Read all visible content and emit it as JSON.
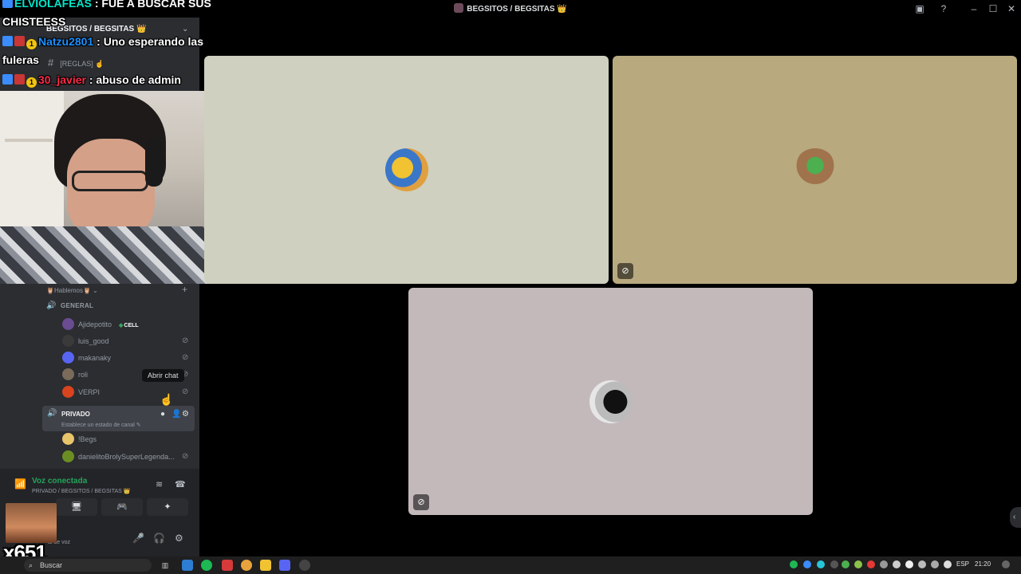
{
  "window": {
    "title": "BEGSITOS / BEGSITAS 👑",
    "icons": [
      "inbox-icon",
      "help-icon",
      "minimize-icon",
      "maximize-icon",
      "close-icon"
    ]
  },
  "sidebar": {
    "server_name": "BEGSITOS / BEGSITAS 👑",
    "rules_channel": "[REGLAS] ☝️",
    "category": "🦉Hablemos🦉",
    "voice_channels": [
      {
        "name": "GENERAL",
        "members": [
          {
            "name": "Ajidepotito",
            "tag": "CELL",
            "tag_color": "#23a55a",
            "muted": false,
            "avatar_color": "#6a4c93"
          },
          {
            "name": "luis_good",
            "muted": true,
            "avatar_color": "#3a3a3a"
          },
          {
            "name": "makanaky",
            "muted": true,
            "avatar_color": "#5865f2"
          },
          {
            "name": "roli",
            "muted": true,
            "avatar_color": "#7a6b5a"
          },
          {
            "name": "VERPI",
            "muted": true,
            "avatar_color": "#d9441f"
          }
        ]
      },
      {
        "name": "PRIVADO",
        "status": "Establece un estado de canal",
        "members": [
          {
            "name": "!Begs",
            "muted": false,
            "avatar_color": "#e8c46a"
          },
          {
            "name": "danielitoBrolySuperLegenda...",
            "muted": true,
            "avatar_color": "#6b8e23"
          }
        ]
      }
    ],
    "tooltip": "Abrir chat"
  },
  "voice_panel": {
    "status": "Voz conectada",
    "location": "PRIVADO / BEGSITOS / BEGSITAS 👑",
    "user_subtext": "al de voz"
  },
  "overlay": {
    "chat": [
      {
        "user": "ELVIOLAFEAS",
        "sep": " : ",
        "text": "FUE A BUSCAR SUS"
      },
      {
        "user": "",
        "sep": "",
        "text": "CHISTEESS"
      },
      {
        "user": "Natzu2801",
        "sep": " : ",
        "text": "Uno esperando las"
      },
      {
        "user": "",
        "sep": "",
        "text": "fuleras"
      },
      {
        "user": "30_javier",
        "sep": " : ",
        "text": "abuso de admin"
      }
    ],
    "badge_count": "1",
    "meme_counter": "x651"
  },
  "stage": {
    "tiles": [
      {
        "label": "participant-1",
        "bg": "#cfd0c0",
        "mic_muted": false
      },
      {
        "label": "participant-2",
        "bg": "#b8a97f",
        "mic_muted": true
      },
      {
        "label": "participant-3",
        "bg": "#c3b9bb",
        "mic_muted": true
      }
    ]
  },
  "taskbar": {
    "search_placeholder": "Buscar",
    "language": "ESP",
    "time": "21:20"
  }
}
